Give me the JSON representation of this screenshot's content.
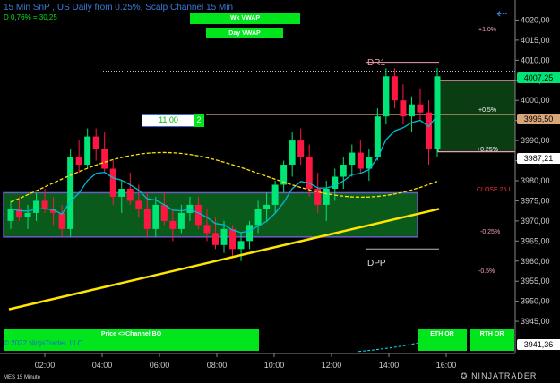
{
  "header": {
    "title": "15 Min SnP , US Daily from 0.25%, Scalp Channel 15 Min",
    "subtitle": "D 0,76% = 30,25"
  },
  "buttons": {
    "wk_vwap": "Wk VWAP",
    "day_vwap": "Day VWAP",
    "price_channel": "Price <>Channel BO",
    "eth_or": "ETH OR",
    "rth_or": "RTH OR"
  },
  "order_qty": {
    "value": "11,00",
    "button": "2"
  },
  "copyright": "© 2022 NinjaTrader, LLC",
  "footer_label": "MES 15 Minute",
  "logo_text": "NINJATRADER",
  "levels": {
    "dr1": "DR1",
    "dpp": "DPP",
    "close": "CLOSE 25 I",
    "pct_plus_1": "+1.0%",
    "pct_plus_05": "+0.5%",
    "pct_plus_025": "+0.25%",
    "pct_minus_025": "-0,25%",
    "pct_minus_05": "-0.5%"
  },
  "price_labels": {
    "last": "4007,25",
    "upper": "3996,50",
    "lower": "3987,21",
    "bottom": "3941,36"
  },
  "colors": {
    "up_candle": "#00e676",
    "down_candle": "#ff1744",
    "vwap_line": "#ffe600",
    "dashed_vwap": "#ffe600",
    "ema_line": "#00bcd4",
    "zone_fill": "#0a5a1c",
    "zone_border": "#6b5cc8",
    "accent_green": "#00e51c",
    "label_blue": "#1e66d0",
    "close_red": "#ff3030"
  },
  "chart_data": {
    "type": "candlestick",
    "yaxis_ticks": [
      "4020,00",
      "4015,00",
      "4010,00",
      "4005,00",
      "4000,00",
      "3995,00",
      "3990,00",
      "3985,00",
      "3980,00",
      "3975,00",
      "3970,00",
      "3965,00",
      "3960,00",
      "3955,00",
      "3950,00",
      "3945,00"
    ],
    "xaxis_ticks": [
      "02:00",
      "04:00",
      "06:00",
      "08:00",
      "10:00",
      "12:00",
      "14:00",
      "16:00"
    ],
    "ylim": [
      3937,
      4025
    ],
    "candles": [
      [
        3970,
        3975,
        3968,
        3973
      ],
      [
        3973,
        3976,
        3970,
        3971
      ],
      [
        3971,
        3974,
        3968,
        3972
      ],
      [
        3972,
        3977,
        3970,
        3975
      ],
      [
        3975,
        3978,
        3972,
        3973
      ],
      [
        3973,
        3976,
        3969,
        3972
      ],
      [
        3972,
        3974,
        3966,
        3968
      ],
      [
        3968,
        3988,
        3966,
        3986
      ],
      [
        3986,
        3990,
        3982,
        3984
      ],
      [
        3984,
        3993,
        3983,
        3991
      ],
      [
        3991,
        3993,
        3985,
        3988
      ],
      [
        3988,
        3992,
        3982,
        3983
      ],
      [
        3983,
        3985,
        3974,
        3976
      ],
      [
        3976,
        3980,
        3972,
        3978
      ],
      [
        3978,
        3982,
        3974,
        3975
      ],
      [
        3975,
        3979,
        3971,
        3973
      ],
      [
        3973,
        3977,
        3966,
        3968
      ],
      [
        3968,
        3976,
        3966,
        3974
      ],
      [
        3974,
        3977,
        3969,
        3970
      ],
      [
        3970,
        3973,
        3965,
        3968
      ],
      [
        3968,
        3974,
        3967,
        3972
      ],
      [
        3972,
        3976,
        3970,
        3974
      ],
      [
        3974,
        3976,
        3968,
        3969
      ],
      [
        3969,
        3973,
        3965,
        3967
      ],
      [
        3967,
        3971,
        3963,
        3964
      ],
      [
        3964,
        3970,
        3962,
        3968
      ],
      [
        3968,
        3969,
        3961,
        3963
      ],
      [
        3963,
        3967,
        3960,
        3965
      ],
      [
        3965,
        3970,
        3963,
        3969
      ],
      [
        3969,
        3975,
        3967,
        3973
      ],
      [
        3973,
        3977,
        3970,
        3974
      ],
      [
        3974,
        3980,
        3972,
        3979
      ],
      [
        3979,
        3985,
        3977,
        3984
      ],
      [
        3984,
        3992,
        3981,
        3990
      ],
      [
        3990,
        3993,
        3984,
        3986
      ],
      [
        3986,
        3989,
        3976,
        3978
      ],
      [
        3978,
        3982,
        3972,
        3974
      ],
      [
        3974,
        3980,
        3970,
        3978
      ],
      [
        3978,
        3983,
        3975,
        3981
      ],
      [
        3981,
        3986,
        3978,
        3984
      ],
      [
        3984,
        3989,
        3981,
        3987
      ],
      [
        3987,
        3990,
        3982,
        3983
      ],
      [
        3983,
        3988,
        3980,
        3986
      ],
      [
        3986,
        3998,
        3985,
        3996
      ],
      [
        3996,
        4008,
        3994,
        4006
      ],
      [
        4006,
        4008,
        3998,
        4000
      ],
      [
        4000,
        4004,
        3994,
        3996
      ],
      [
        3996,
        4001,
        3992,
        3999
      ],
      [
        3999,
        4003,
        3995,
        3997
      ],
      [
        3997,
        4000,
        3984,
        3988
      ],
      [
        3988,
        4008,
        3986,
        4006
      ]
    ],
    "vwap": {
      "start": 3948,
      "end": 3973
    },
    "zone": {
      "top": 3977,
      "bottom": 3966
    },
    "right_zone": {
      "top": 4005,
      "bottom": 3987.2
    },
    "horizontal_levels": {
      "dr1": 4009.5,
      "dotted": 4007.25,
      "upper": 3996.5,
      "dpp": 3963
    }
  }
}
